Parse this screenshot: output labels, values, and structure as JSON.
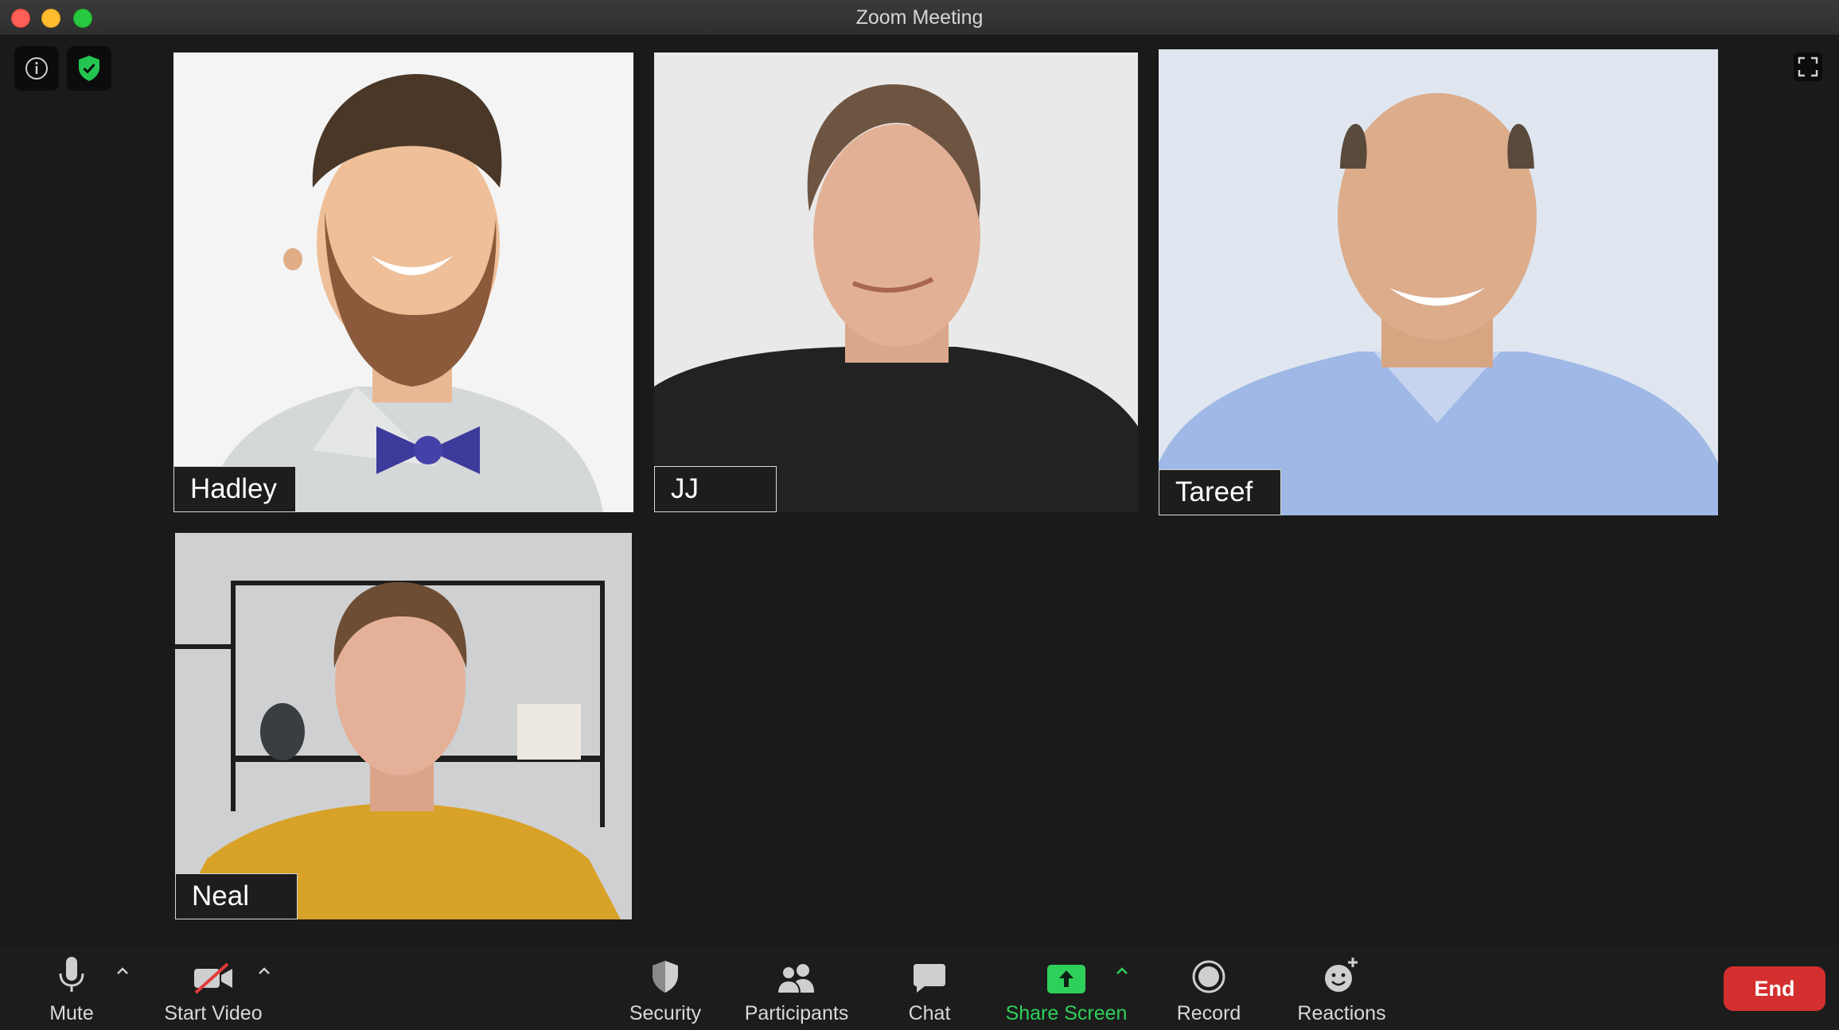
{
  "window": {
    "title": "Zoom Meeting"
  },
  "participants": [
    {
      "name": "Hadley"
    },
    {
      "name": "JJ"
    },
    {
      "name": "Tareef"
    },
    {
      "name": "Neal"
    }
  ],
  "toolbar": {
    "mute_label": "Mute",
    "start_video_label": "Start Video",
    "security_label": "Security",
    "participants_label": "Participants",
    "chat_label": "Chat",
    "share_screen_label": "Share Screen",
    "record_label": "Record",
    "reactions_label": "Reactions",
    "end_label": "End"
  },
  "colors": {
    "background": "#1a1a1a",
    "share_green": "#2fd05a",
    "end_red": "#d42f2f",
    "encryption_green": "#23c552"
  },
  "icons": [
    "info-icon",
    "encryption-shield-icon",
    "fullscreen-icon",
    "microphone-icon",
    "video-off-icon",
    "security-shield-icon",
    "participants-icon",
    "chat-icon",
    "share-screen-icon",
    "record-icon",
    "reactions-icon"
  ]
}
